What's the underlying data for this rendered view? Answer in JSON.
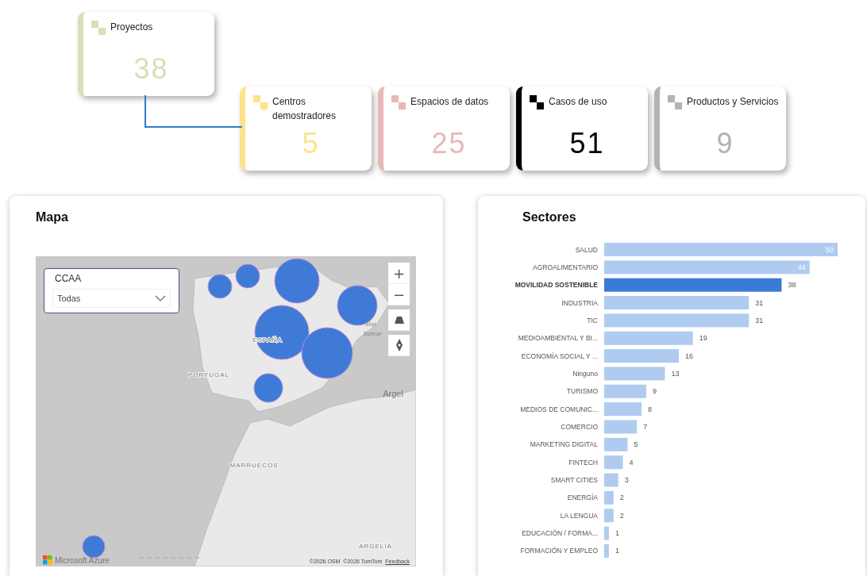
{
  "kpis": [
    {
      "label": "Proyectos",
      "value": "38",
      "color": "#d5e2b8"
    },
    {
      "label": "Centros demostradores",
      "value": "5",
      "color": "#fde48c"
    },
    {
      "label": "Espacios de datos",
      "value": "25",
      "color": "#e8b8b8"
    },
    {
      "label": "Casos de uso",
      "value": "51",
      "color": "#000000"
    },
    {
      "label": "Productos y Servicios",
      "value": "9",
      "color": "#b3b3b3"
    }
  ],
  "map_panel": {
    "title": "Mapa",
    "filter": {
      "label": "CCAA",
      "value": "Todas"
    },
    "map_labels": [
      {
        "text": "ESPAÑA",
        "kind": "country"
      },
      {
        "text": "PORTUGAL",
        "kind": "country"
      },
      {
        "text": "Mar",
        "kind": "sea"
      },
      {
        "text": "Balear",
        "kind": "sea"
      },
      {
        "text": "Argel",
        "kind": "city"
      },
      {
        "text": "MARRUECOS",
        "kind": "country"
      },
      {
        "text": "ARGELIA",
        "kind": "country"
      }
    ],
    "controls": [
      "+",
      "−"
    ],
    "brand": "Microsoft Azure",
    "copyright": "©2026 OSM  ©2026 TomTom",
    "feedback_link": "Feedback"
  },
  "sectors_panel": {
    "title": "Sectores",
    "chart_data": {
      "type": "bar",
      "orientation": "horizontal",
      "data_labels": true,
      "categories": [
        "SALUD",
        "AGROALIMENTARIO",
        "MOVILIDAD SOSTENIBLE",
        "INDUSTRIA",
        "TIC",
        "MEDIOAMBIENTAL Y BI...",
        "ECONOMÍA SOCIAL Y ...",
        "Ninguno",
        "TURISMO",
        "MEDIOS DE COMUNIC...",
        "COMERCIO",
        "MARKETING DIGITAL",
        "FINTECH",
        "SMART CITIES",
        "ENERGÍA",
        "LA LENGUA",
        "EDUCACIÓN / FORMA...",
        "FORMACIÓN Y EMPLEO"
      ],
      "series": [
        {
          "values": [
            50,
            44,
            38,
            31,
            31,
            19,
            16,
            13,
            9,
            8,
            7,
            5,
            4,
            3,
            2,
            2,
            1,
            1
          ]
        }
      ]
    },
    "bar_states": [
      {
        "selected": false,
        "color": "#afcbf0"
      },
      {
        "selected": false,
        "color": "#afcbf0"
      },
      {
        "selected": true,
        "color": "#3a7bd5"
      },
      {
        "selected": false,
        "color": "#afcbf0"
      },
      {
        "selected": false,
        "color": "#afcbf0"
      },
      {
        "selected": false,
        "color": "#afcbf0"
      },
      {
        "selected": false,
        "color": "#afcbf0"
      },
      {
        "selected": false,
        "color": "#afcbf0"
      },
      {
        "selected": false,
        "color": "#afcbf0"
      },
      {
        "selected": false,
        "color": "#afcbf0"
      },
      {
        "selected": false,
        "color": "#afcbf0"
      },
      {
        "selected": false,
        "color": "#afcbf0"
      },
      {
        "selected": false,
        "color": "#afcbf0"
      },
      {
        "selected": false,
        "color": "#afcbf0"
      },
      {
        "selected": false,
        "color": "#afcbf0"
      },
      {
        "selected": false,
        "color": "#afcbf0"
      },
      {
        "selected": false,
        "color": "#afcbf0"
      },
      {
        "selected": false,
        "color": "#afcbf0"
      }
    ]
  }
}
